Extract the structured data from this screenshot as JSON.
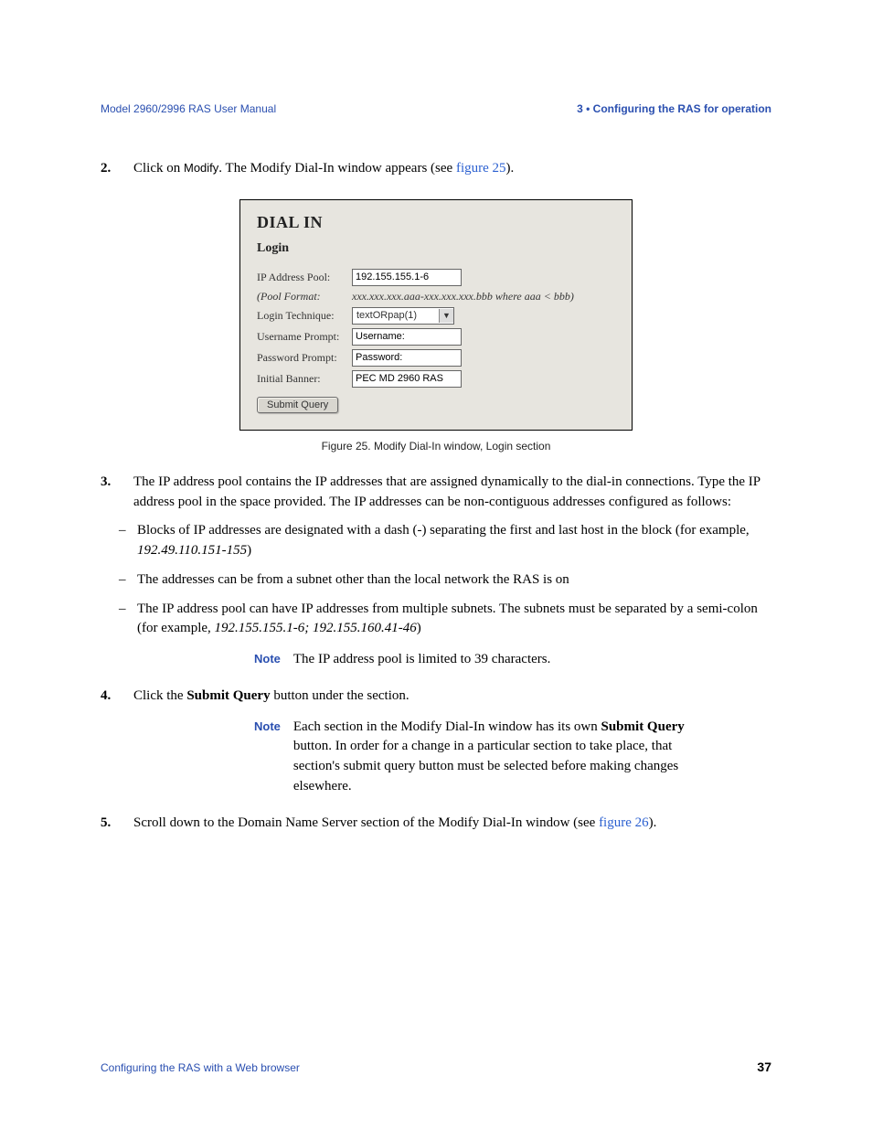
{
  "header": {
    "left": "Model 2960/2996 RAS User Manual",
    "right": "3 • Configuring the RAS for operation"
  },
  "steps": {
    "s2": {
      "num": "2.",
      "t1": "Click on ",
      "modify": "Modify",
      "t2": ". The Modify Dial-In window appears (see ",
      "figref": "figure 25",
      "t3": ")."
    },
    "s3": {
      "num": "3.",
      "body": "The IP address pool contains the IP addresses that are assigned dynamically to the dial-in connections. Type the IP address pool in the space provided. The IP addresses can be non-contiguous addresses configured as follows:"
    },
    "s4": {
      "num": "4.",
      "t1": "Click the ",
      "bold": "Submit Query",
      "t2": " button under the section."
    },
    "s5": {
      "num": "5.",
      "t1": "Scroll down to the Domain Name Server section of the Modify Dial-In window (see ",
      "figref": "figure 26",
      "t2": ")."
    }
  },
  "sublist": {
    "i1": {
      "t1": "Blocks of IP addresses are designated with a dash (-) separating the first and last host in the block (for example, ",
      "ex": "192.49.110.151-155",
      "t2": ")"
    },
    "i2": {
      "t1": "The addresses can be from a subnet other than the local network the RAS is on"
    },
    "i3": {
      "t1": "The IP address pool can have IP addresses from multiple subnets. The subnets must be separated by a semi-colon (for example, ",
      "ex": "192.155.155.1-6; 192.155.160.41-46",
      "t2": ")"
    }
  },
  "notes": {
    "label": "Note",
    "n1": "The IP address pool is limited to 39 characters.",
    "n2a": "Each section in the Modify Dial-In window has its own ",
    "n2b": "Submit Query",
    "n2c": " button. In order for a change in a particular section to take place, that section's submit query button must be selected before making changes elsewhere."
  },
  "figure": {
    "caption": "Figure 25. Modify Dial-In window, Login section",
    "title": "DIAL IN",
    "subtitle": "Login",
    "rows": {
      "ip_label": "IP Address Pool:",
      "ip_value": "192.155.155.1-6",
      "pf_label": "(Pool Format:",
      "pf_value": "xxx.xxx.xxx.aaa-xxx.xxx.xxx.bbb where aaa < bbb)",
      "lt_label": "Login Technique:",
      "lt_value": "textORpap(1)",
      "up_label": "Username Prompt:",
      "up_value": "Username:",
      "pp_label": "Password Prompt:",
      "pp_value": "Password:",
      "ib_label": "Initial Banner:",
      "ib_value": "PEC MD 2960 RAS"
    },
    "submit": "Submit Query"
  },
  "footer": {
    "left": "Configuring the RAS with a Web browser",
    "page": "37"
  }
}
